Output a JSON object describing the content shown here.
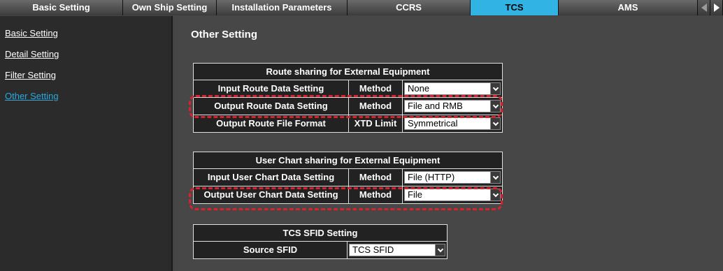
{
  "tabs": [
    {
      "label": "Basic Setting",
      "active": false
    },
    {
      "label": "Own Ship Setting",
      "active": false
    },
    {
      "label": "Installation Parameters",
      "active": false
    },
    {
      "label": "CCRS",
      "active": false
    },
    {
      "label": "TCS",
      "active": true
    },
    {
      "label": "AMS",
      "active": false
    }
  ],
  "tab_nav": {
    "prev_icon": "arrow-left-icon",
    "next_icon": "arrow-right-icon"
  },
  "sidebar": {
    "items": [
      {
        "label": "Basic Setting",
        "active": false
      },
      {
        "label": "Detail Setting",
        "active": false
      },
      {
        "label": "Filter Setting",
        "active": false
      },
      {
        "label": "Other Setting",
        "active": true
      }
    ]
  },
  "main": {
    "title": "Other Setting",
    "route_sharing": {
      "header": "Route sharing for External Equipment",
      "rows": [
        {
          "label": "Input Route Data Setting",
          "param": "Method",
          "value": "None"
        },
        {
          "label": "Output Route Data Setting",
          "param": "Method",
          "value": "File and RMB"
        },
        {
          "label": "Output Route File Format",
          "param": "XTD Limit",
          "value": "Symmetrical"
        }
      ]
    },
    "user_chart_sharing": {
      "header": "User Chart sharing for External Equipment",
      "rows": [
        {
          "label": "Input User Chart Data Setting",
          "param": "Method",
          "value": "File (HTTP)"
        },
        {
          "label": "Output User Chart Data Setting",
          "param": "Method",
          "value": "File"
        }
      ]
    },
    "sfid": {
      "header": "TCS SFID Setting",
      "rows": [
        {
          "label": "Source SFID",
          "value": "TCS SFID"
        }
      ]
    }
  },
  "colors": {
    "accent": "#31b4e4",
    "active_link": "#29a9e0",
    "highlight": "#d6232f",
    "panel_bg": "#222222",
    "main_bg": "#474747"
  }
}
